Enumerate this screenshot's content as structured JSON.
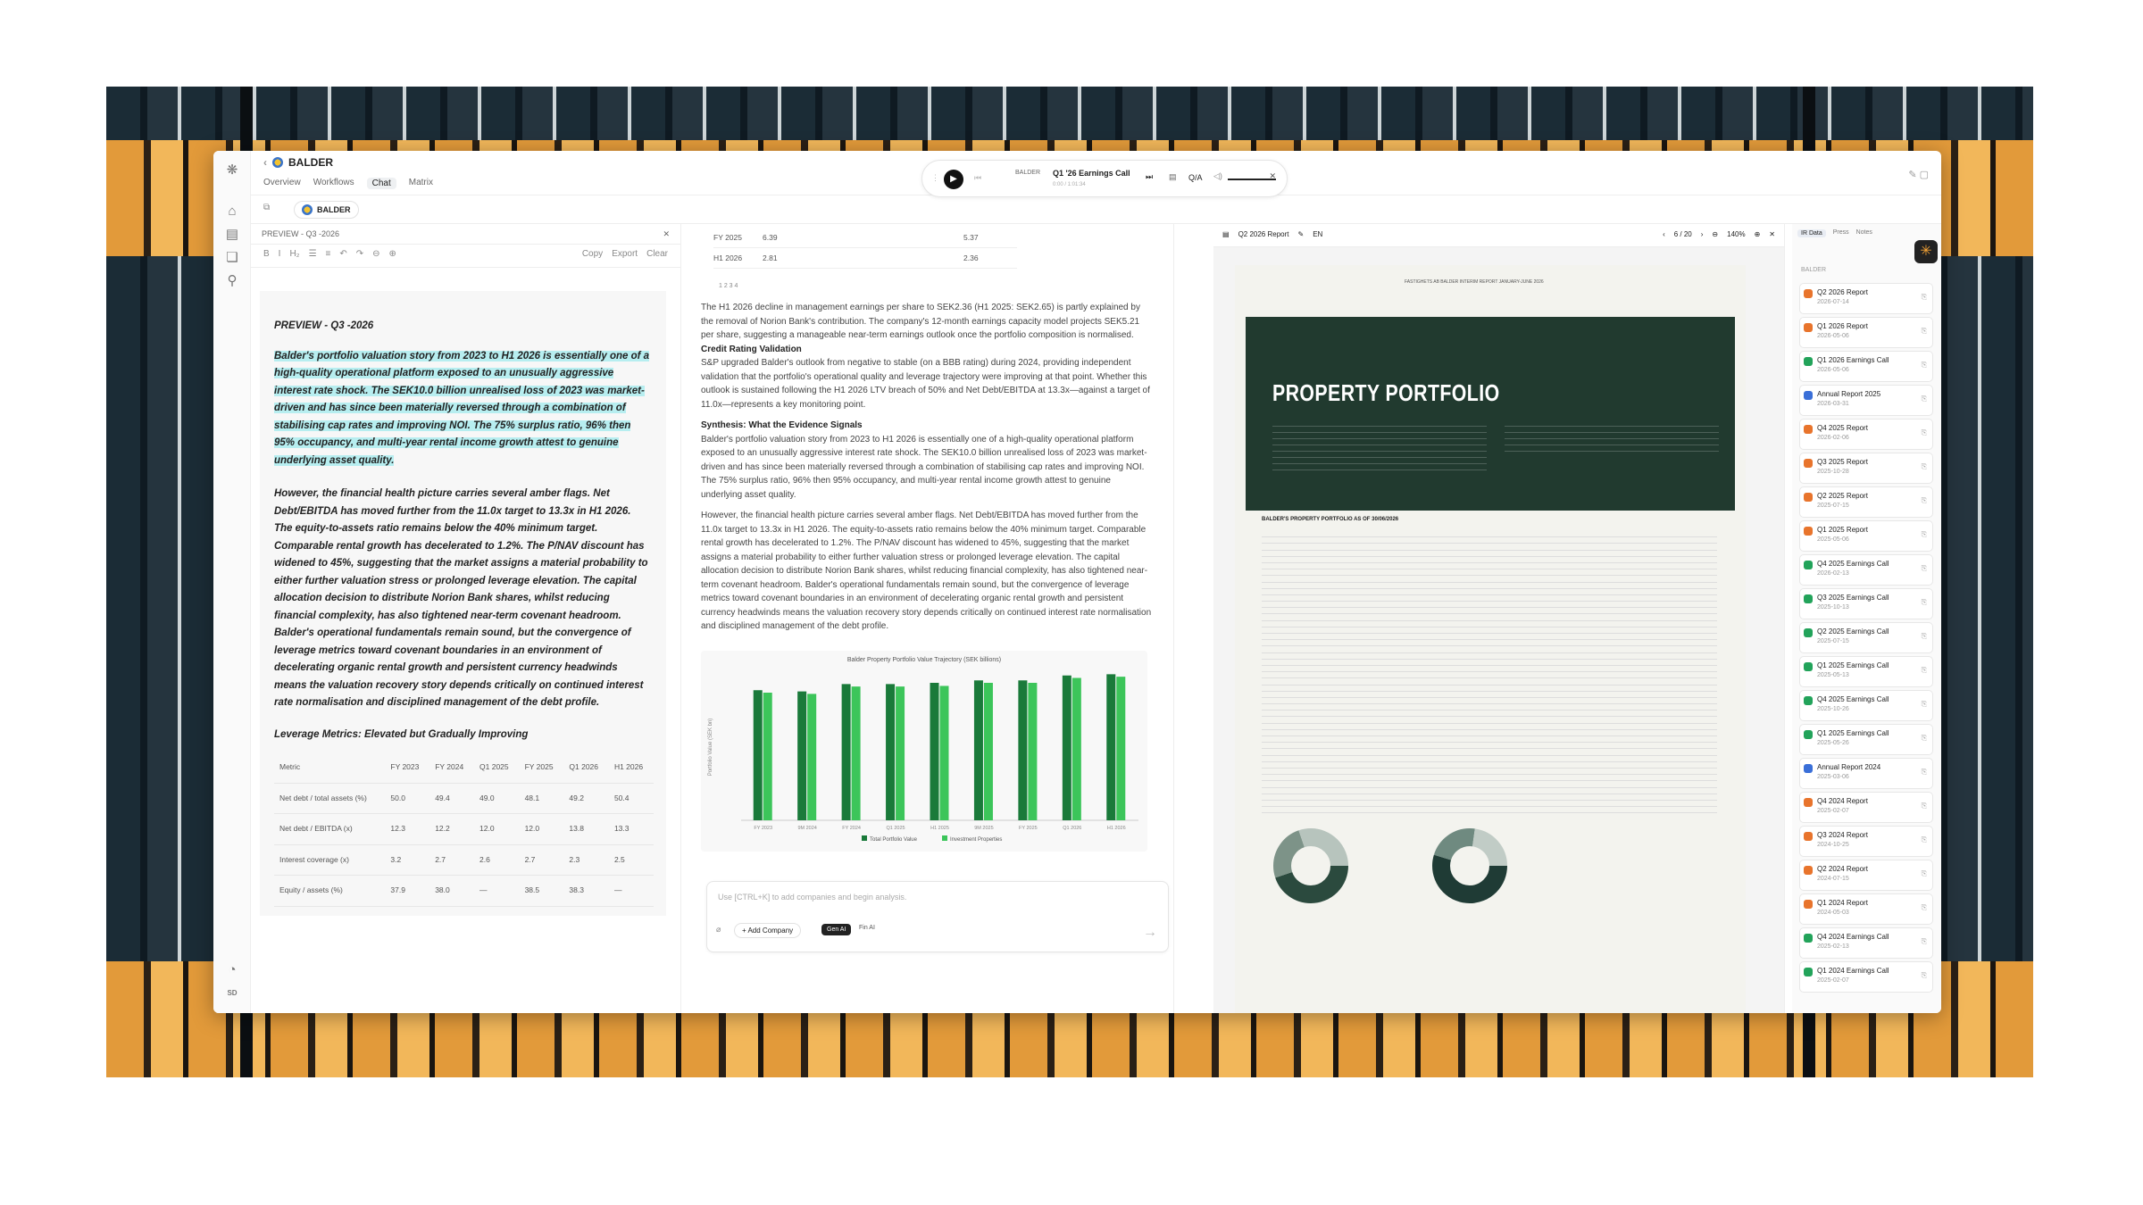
{
  "app": {
    "company": "BALDER",
    "tabs": [
      "Overview",
      "Workflows",
      "Chat",
      "Matrix"
    ],
    "active_tab": "Chat",
    "chip": "BALDER"
  },
  "player": {
    "company": "BALDER",
    "title": "Q1 '26 Earnings Call",
    "time": "0:00 / 1:01:34",
    "qa": "Q/A"
  },
  "preview": {
    "header": "PREVIEW - Q3 -2026",
    "tools": [
      "Copy",
      "Export",
      "Clear"
    ],
    "heading": "PREVIEW - Q3 -2026",
    "p1": "Balder's portfolio valuation story from 2023 to H1 2026 is essentially one of a high-quality operational platform exposed to an unusually aggressive interest rate shock. The SEK10.0 billion unrealised loss of 2023 was market-driven and has since been materially reversed through a combination of stabilising cap rates and improving NOI. The 75% surplus ratio, 96% then 95% occupancy, and multi-year rental income growth attest to genuine underlying asset quality.",
    "p2": "However, the financial health picture carries several amber flags. Net Debt/EBITDA has moved further from the 11.0x target to 13.3x in H1 2026. The equity-to-assets ratio remains below the 40% minimum target. Comparable rental growth has decelerated to 1.2%. The P/NAV discount has widened to 45%, suggesting that the market assigns a material probability to either further valuation stress or prolonged leverage elevation. The capital allocation decision to distribute Norion Bank shares, whilst reducing financial complexity, has also tightened near-term covenant headroom. Balder's operational fundamentals remain sound, but the convergence of leverage metrics toward covenant boundaries in an environment of decelerating organic rental growth and persistent currency headwinds means the valuation recovery story depends critically on continued interest rate normalisation and disciplined management of the debt profile.",
    "lev_title": "Leverage Metrics: Elevated but Gradually Improving",
    "table": {
      "headers": [
        "Metric",
        "FY 2023",
        "FY 2024",
        "Q1 2025",
        "FY 2025",
        "Q1 2026",
        "H1 2026"
      ],
      "rows": [
        [
          "Net debt / total assets (%)",
          "50.0",
          "49.4",
          "49.0",
          "48.1",
          "49.2",
          "50.4"
        ],
        [
          "Net debt / EBITDA (x)",
          "12.3",
          "12.2",
          "12.0",
          "12.0",
          "13.8",
          "13.3"
        ],
        [
          "Interest coverage (x)",
          "3.2",
          "2.7",
          "2.6",
          "2.7",
          "2.3",
          "2.5"
        ],
        [
          "Equity / assets (%)",
          "37.9",
          "38.0",
          "—",
          "38.5",
          "38.3",
          "—"
        ]
      ]
    }
  },
  "chat": {
    "top_rows": [
      [
        "FY 2025",
        "6.39",
        "5.37"
      ],
      [
        "H1 2026",
        "2.81",
        "2.36"
      ]
    ],
    "pages": "1  2  3  4",
    "para1": "The H1 2026 decline in management earnings per share to SEK2.36 (H1 2025: SEK2.65) is partly explained by the removal of Norion Bank's contribution. The company's 12-month earnings capacity model projects SEK5.21 per share, suggesting a manageable near-term earnings outlook once the portfolio composition is normalised.",
    "h_credit": "Credit Rating Validation",
    "para2": "S&P upgraded Balder's outlook from negative to stable (on a BBB rating) during 2024, providing independent validation that the portfolio's operational quality and leverage trajectory were improving at that point. Whether this outlook is sustained following the H1 2026 LTV breach of 50% and Net Debt/EBITDA at 13.3x—against a target of 11.0x—represents a key monitoring point.",
    "h_syn": "Synthesis: What the Evidence Signals",
    "para3": "Balder's portfolio valuation story from 2023 to H1 2026 is essentially one of a high-quality operational platform exposed to an unusually aggressive interest rate shock. The SEK10.0 billion unrealised loss of 2023 was market-driven and has since been materially reversed through a combination of stabilising cap rates and improving NOI. The 75% surplus ratio, 96% then 95% occupancy, and multi-year rental income growth attest to genuine underlying asset quality.",
    "para4": "However, the financial health picture carries several amber flags. Net Debt/EBITDA has moved further from the 11.0x target to 13.3x in H1 2026. The equity-to-assets ratio remains below the 40% minimum target. Comparable rental growth has decelerated to 1.2%. The P/NAV discount has widened to 45%, suggesting that the market assigns a material probability to either further valuation stress or prolonged leverage elevation. The capital allocation decision to distribute Norion Bank shares, whilst reducing financial complexity, has also tightened near-term covenant headroom. Balder's operational fundamentals remain sound, but the convergence of leverage metrics toward covenant boundaries in an environment of decelerating organic rental growth and persistent currency headwinds means the valuation recovery story depends critically on continued interest rate normalisation and disciplined management of the debt profile.",
    "input_placeholder": "Use [CTRL+K] to add companies and begin analysis.",
    "add_company": "Add Company",
    "gen_ai": "Gen AI",
    "fin_ai": "Fin AI"
  },
  "chart_data": {
    "type": "bar",
    "title": "Balder Property Portfolio Value Trajectory (SEK billions)",
    "ylabel": "Portfolio Value (SEK bn)",
    "categories": [
      "FY 2023",
      "9M 2024",
      "FY 2024",
      "Q1 2025",
      "H1 2025",
      "9M 2025",
      "FY 2025",
      "Q1 2026",
      "H1 2026"
    ],
    "ylim": [
      0,
      240
    ],
    "series": [
      {
        "name": "Total Portfolio Value",
        "color": "#1a7a3a",
        "values": [
          212,
          210,
          222,
          222,
          224,
          228,
          228,
          236,
          238
        ]
      },
      {
        "name": "Investment Properties",
        "color": "#3cc55a",
        "values": [
          208,
          206,
          218,
          218,
          219,
          224,
          224,
          232,
          234
        ]
      }
    ]
  },
  "viewer": {
    "doc": "Q2 2026 Report",
    "lang": "EN",
    "page": "6 / 20",
    "zoom": "140%",
    "running_head": "FASTIGHETS AB BALDER INTERIM REPORT JANUARY-JUNE 2026",
    "title": "PROPERTY PORTFOLIO",
    "table_title": "BALDER'S PROPERTY PORTFOLIO AS OF 30/06/2026"
  },
  "sidebar": {
    "tabs": [
      "IR Data",
      "Press",
      "Notes"
    ],
    "group": "BALDER",
    "items": [
      {
        "t": "Q2 2026 Report",
        "d": "2026-07-14",
        "c": "#e8742c"
      },
      {
        "t": "Q1 2026 Report",
        "d": "2026-05-06",
        "c": "#e8742c"
      },
      {
        "t": "Q1 2026 Earnings Call",
        "d": "2026-05-06",
        "c": "#22a35a"
      },
      {
        "t": "Annual Report 2025",
        "d": "2026-03-31",
        "c": "#3a6fd8"
      },
      {
        "t": "Q4 2025 Report",
        "d": "2026-02-06",
        "c": "#e8742c"
      },
      {
        "t": "Q3 2025 Report",
        "d": "2025-10-28",
        "c": "#e8742c"
      },
      {
        "t": "Q2 2025 Report",
        "d": "2025-07-15",
        "c": "#e8742c"
      },
      {
        "t": "Q1 2025 Report",
        "d": "2025-05-06",
        "c": "#e8742c"
      },
      {
        "t": "Q4 2025 Earnings Call",
        "d": "2026-02-13",
        "c": "#22a35a"
      },
      {
        "t": "Q3 2025 Earnings Call",
        "d": "2025-10-13",
        "c": "#22a35a"
      },
      {
        "t": "Q2 2025 Earnings Call",
        "d": "2025-07-15",
        "c": "#22a35a"
      },
      {
        "t": "Q1 2025 Earnings Call",
        "d": "2025-05-13",
        "c": "#22a35a"
      },
      {
        "t": "Q4 2025 Earnings Call",
        "d": "2025-10-26",
        "c": "#22a35a"
      },
      {
        "t": "Q1 2025 Earnings Call",
        "d": "2025-05-26",
        "c": "#22a35a"
      },
      {
        "t": "Annual Report 2024",
        "d": "2025-03-06",
        "c": "#3a6fd8"
      },
      {
        "t": "Q4 2024 Report",
        "d": "2025-02-07",
        "c": "#e8742c"
      },
      {
        "t": "Q3 2024 Report",
        "d": "2024-10-25",
        "c": "#e8742c"
      },
      {
        "t": "Q2 2024 Report",
        "d": "2024-07-15",
        "c": "#e8742c"
      },
      {
        "t": "Q1 2024 Report",
        "d": "2024-05-03",
        "c": "#e8742c"
      },
      {
        "t": "Q4 2024 Earnings Call",
        "d": "2025-02-13",
        "c": "#22a35a"
      },
      {
        "t": "Q1 2024 Earnings Call",
        "d": "2025-02-07",
        "c": "#22a35a"
      }
    ]
  }
}
